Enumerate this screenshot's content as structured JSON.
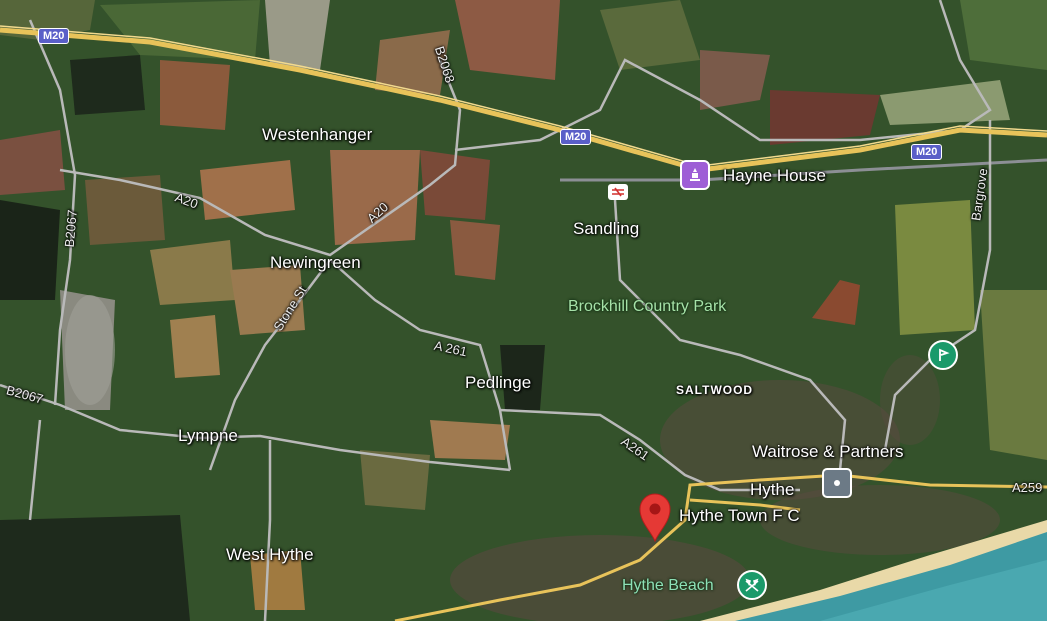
{
  "map": {
    "style": "satellite",
    "colors": {
      "motorway": "#e8c35a",
      "road": "#b9b9b9",
      "pin": "#e53935",
      "landmark": "#9e5fd6",
      "park_marker": "#1a9a6a",
      "sea": "#3e9aa3",
      "beach": "#e9d9a8"
    },
    "places": [
      {
        "label": "Westenhanger"
      },
      {
        "label": "Newingreen"
      },
      {
        "label": "Sandling"
      },
      {
        "label": "Pedlinge"
      },
      {
        "label": "Lympne"
      },
      {
        "label": "West Hythe"
      },
      {
        "label": "SALTWOOD"
      },
      {
        "label": "Hythe"
      }
    ],
    "road_labels": [
      "A20",
      "A20",
      "A 261",
      "A261",
      "Stone St",
      "B2067",
      "B2067",
      "B2068",
      "Bargrove",
      "A259"
    ],
    "motorway_shields": [
      "M20",
      "M20",
      "M20"
    ],
    "pois": {
      "hayne_house": {
        "label": "Hayne House",
        "icon": "landmark-icon"
      },
      "brockhill": {
        "label": "Brockhill Country Park"
      },
      "waitrose": {
        "label": "Waitrose & Partners",
        "icon": "shopping-icon"
      },
      "hythe_fc": {
        "label": "Hythe Town F C",
        "icon": "map-pin-icon"
      },
      "hythe_beach": {
        "label": "Hythe Beach",
        "icon": "beach-icon"
      },
      "golf": {
        "icon": "golf-icon"
      },
      "rail": {
        "icon": "rail-station-icon"
      }
    }
  }
}
